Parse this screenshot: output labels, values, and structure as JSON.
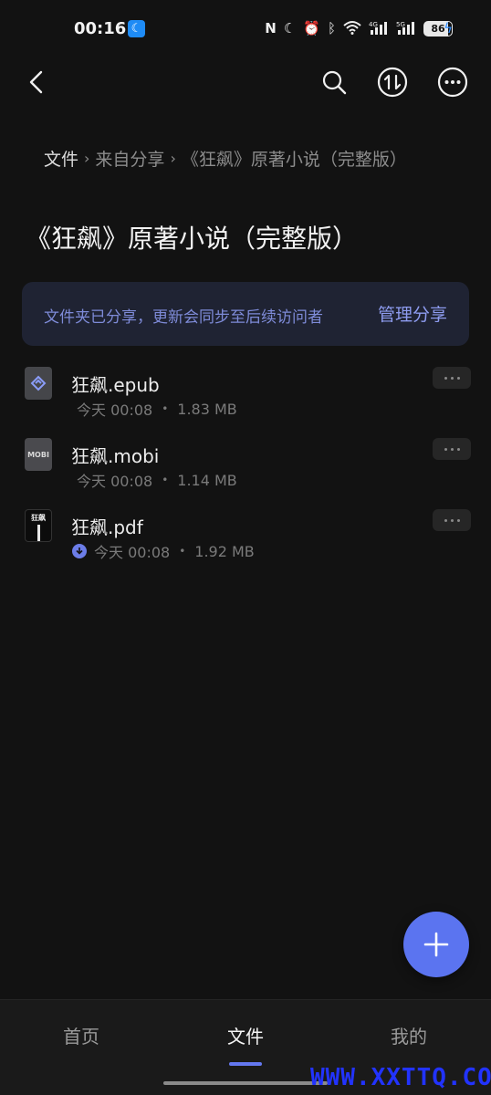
{
  "status_bar": {
    "time": "00:16",
    "battery": "86",
    "icons": [
      "nfc-icon",
      "moon-icon",
      "alarm-icon",
      "bluetooth-icon",
      "wifi-icon",
      "signal-4g-icon",
      "signal-5g-icon",
      "charging-icon"
    ],
    "network_labels": [
      "4G",
      "5G"
    ]
  },
  "breadcrumb": {
    "root": "文件",
    "middle": "来自分享",
    "current": "《狂飙》原著小说（完整版）"
  },
  "page_title": "《狂飙》原著小说（完整版）",
  "share_banner": {
    "text": "文件夹已分享，更新会同步至后续访问者",
    "action": "管理分享"
  },
  "files": [
    {
      "name": "狂飙.epub",
      "time": "今天 00:08",
      "size": "1.83 MB",
      "icon": "epub-file-icon"
    },
    {
      "name": "狂飙.mobi",
      "time": "今天 00:08",
      "size": "1.14 MB",
      "icon": "mobi-file-icon",
      "icon_text": "MOBI"
    },
    {
      "name": "狂飙.pdf",
      "time": "今天 00:08",
      "size": "1.92 MB",
      "icon": "pdf-file-icon",
      "icon_text": "狂飙",
      "downloaded": true
    }
  ],
  "bottom_nav": {
    "items": [
      {
        "label": "首页"
      },
      {
        "label": "文件",
        "active": true
      },
      {
        "label": "我的"
      }
    ]
  },
  "watermark": "WWW.XXTTQ.COM",
  "colors": {
    "background": "#121212",
    "accent": "#5b74f0",
    "banner_bg": "#1f2333",
    "banner_text": "#7e8bd8"
  }
}
